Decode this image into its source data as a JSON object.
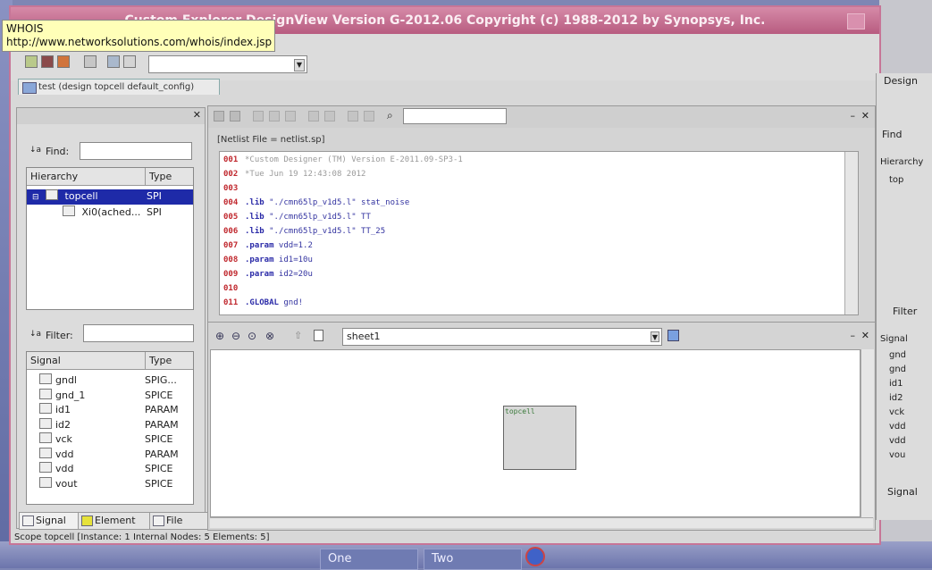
{
  "window": {
    "title": "Custom Explorer DesignView Version G-2012.06 Copyright (c) 1988-2012 by Synopsys, Inc."
  },
  "tooltip": {
    "line1": "WHOIS",
    "line2": "http://www.networksolutions.com/whois/index.jsp"
  },
  "doc_tab": {
    "label": "test (design topcell default_config)"
  },
  "hierarchy_panel": {
    "find_label": "Find:",
    "columns": [
      "Hierarchy",
      "Type"
    ],
    "rows": [
      {
        "name": "topcell",
        "type": "SPI",
        "selected": true
      },
      {
        "name": "Xi0(ached...",
        "type": "SPI",
        "selected": false
      }
    ]
  },
  "signal_panel": {
    "filter_label": "Filter:",
    "columns": [
      "Signal",
      "Type"
    ],
    "rows": [
      {
        "name": "gndl",
        "type": "SPIG..."
      },
      {
        "name": "gnd_1",
        "type": "SPICE"
      },
      {
        "name": "id1",
        "type": "PARAM"
      },
      {
        "name": "id2",
        "type": "PARAM"
      },
      {
        "name": "vck",
        "type": "SPICE"
      },
      {
        "name": "vdd",
        "type": "PARAM"
      },
      {
        "name": "vdd",
        "type": "SPICE"
      },
      {
        "name": "vout",
        "type": "SPICE"
      }
    ]
  },
  "bottom_tabs": [
    "Signal",
    "Element",
    "File"
  ],
  "netlist": {
    "header": "[Netlist File = netlist.sp]",
    "lines": [
      {
        "num": "001",
        "text": "*Custom Designer (TM) Version E-2011.09-SP3-1",
        "kind": "comment"
      },
      {
        "num": "002",
        "text": "*Tue Jun 19 12:43:08 2012",
        "kind": "comment"
      },
      {
        "num": "003",
        "text": "",
        "kind": "plain"
      },
      {
        "num": "004",
        "kw": ".lib",
        "text": " \"./cmn65lp_v1d5.l\" stat_noise",
        "kind": "code"
      },
      {
        "num": "005",
        "kw": ".lib",
        "text": " \"./cmn65lp_v1d5.l\" TT",
        "kind": "code"
      },
      {
        "num": "006",
        "kw": ".lib",
        "text": " \"./cmn65lp_v1d5.l\" TT_25",
        "kind": "code"
      },
      {
        "num": "007",
        "kw": ".param",
        "text": " vdd=1.2",
        "kind": "code"
      },
      {
        "num": "008",
        "kw": ".param",
        "text": " id1=10u",
        "kind": "code"
      },
      {
        "num": "009",
        "kw": ".param",
        "text": " id2=20u",
        "kind": "code"
      },
      {
        "num": "010",
        "text": "",
        "kind": "plain"
      },
      {
        "num": "011",
        "kw": ".GLOBAL",
        "text": " gnd!",
        "kind": "code"
      }
    ]
  },
  "schematic": {
    "sheet": "sheet1",
    "cell_label": "topcell"
  },
  "status_bar": "Scope topcell [Instance: 1 Internal Nodes: 5 Elements: 5]",
  "right_window": {
    "design_tab": "Design",
    "find_label": "Find",
    "hierarchy_header": "Hierarchy",
    "tree_item": "top",
    "filter_label": "Filter",
    "signal_header": "Signal",
    "signals": [
      "gnd",
      "gnd",
      "id1",
      "id2",
      "vck",
      "vdd",
      "vdd",
      "vou"
    ],
    "signal_tab": "Signal"
  },
  "taskbar": {
    "items": [
      "One",
      "Two"
    ]
  }
}
